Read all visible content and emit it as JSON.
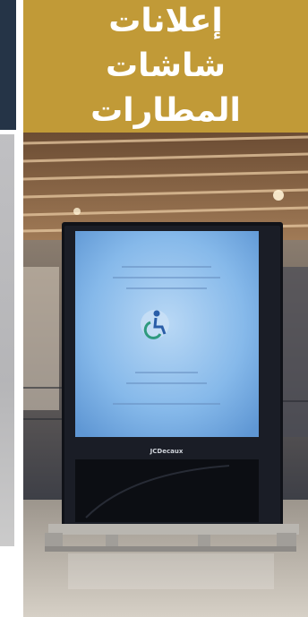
{
  "header": {
    "title": "إعلانات شاشات المطارات"
  },
  "photo": {
    "subject": "airport-digital-screen-kiosk",
    "brand_text": "JCDecaux",
    "colors": {
      "header_bg": "#c19a37",
      "screen_blue": "#7fb6ea",
      "ceiling": "#7a5a3e",
      "floor": "#c8c0b5"
    }
  }
}
